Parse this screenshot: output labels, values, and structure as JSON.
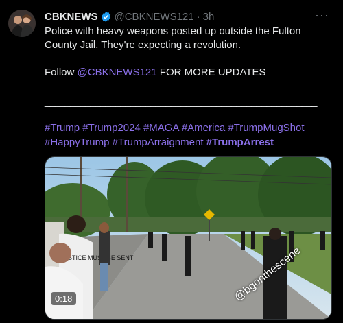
{
  "author": {
    "display_name": "CBKNEWS",
    "handle": "@CBKNEWS121",
    "separator": "·",
    "time": "3h",
    "more_label": "···"
  },
  "tweet": {
    "line1": "Police with heavy weapons posted up outside the Fulton County Jail. They're expecting a revolution.",
    "follow_prefix": "Follow ",
    "follow_handle": "@CBKNEWS121",
    "follow_suffix": " FOR MORE UPDATES",
    "rule": "______________________________________________________"
  },
  "hashtags": [
    "#Trump",
    "#Trump2024",
    "#MAGA",
    "#America",
    "#TrumpMugShot",
    "#HappyTrump",
    "#TrumpArraignment"
  ],
  "hashtag_bold": "#TrumpArrest",
  "video": {
    "duration": "0:18",
    "watermark": "@bgonthescene",
    "shirt_text": "JUSTICE MUST BE SENT"
  },
  "colors": {
    "link": "#8a6fe8",
    "verified": "#1d9bf0",
    "background": "#000000"
  }
}
